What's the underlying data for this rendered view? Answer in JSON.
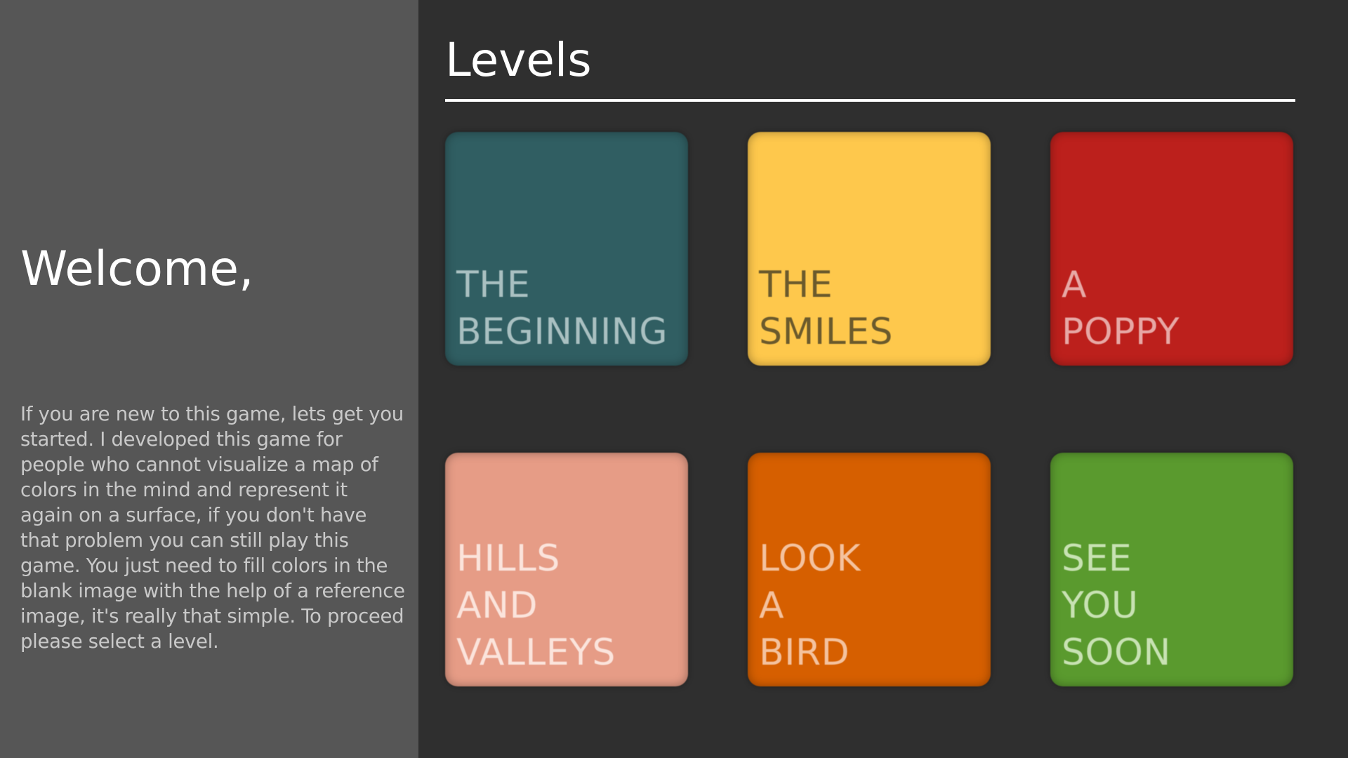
{
  "sidebar": {
    "welcome": "Welcome,",
    "intro": "If you are new to this game, lets get you started. I developed this game for people who cannot visualize a  map of colors in the mind and represent it again on a surface, if you don't have that problem you can still play this game. You just need to fill colors in the blank image with the help of a reference image, it's really that simple. To proceed please select a level."
  },
  "main": {
    "title": "Levels",
    "levels": [
      {
        "label": "THE\nBEGINNING",
        "bg": "#305e62",
        "text_color": "#a9c0c1"
      },
      {
        "label": "THE\nSMILES",
        "bg": "#fec84c",
        "text_color": "#6b5a2c"
      },
      {
        "label": "A\nPOPPY",
        "bg": "#bc201c",
        "text_color": "#e7a8a5"
      },
      {
        "label": "HILLS\nAND\nVALLEYS",
        "bg": "#e69c86",
        "text_color": "#fbe4dc"
      },
      {
        "label": "LOOK\nA\nBIRD",
        "bg": "#d65f00",
        "text_color": "#f4c29e"
      },
      {
        "label": "SEE\nYOU\nSOON",
        "bg": "#5a9a2e",
        "text_color": "#c8e2b3"
      }
    ]
  }
}
